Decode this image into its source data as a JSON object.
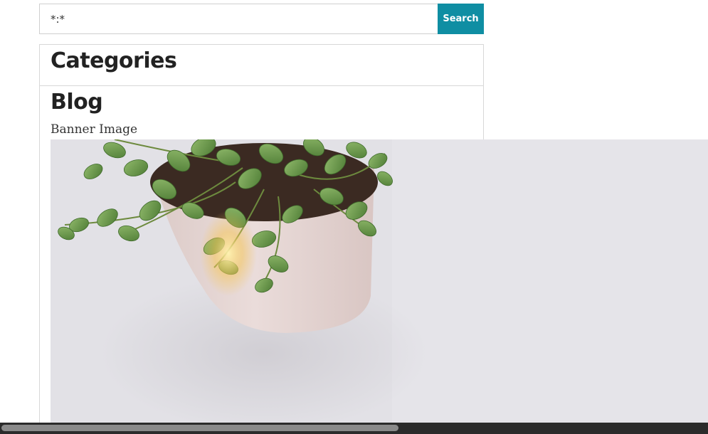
{
  "search": {
    "value": "*:*",
    "button_label": "Search"
  },
  "categories": {
    "title": "Categories"
  },
  "blog": {
    "title": "Blog",
    "banner_label": "Banner Image"
  },
  "banner": {
    "icon": "potted-plant-photo",
    "colors": {
      "background": "#e1e0e5",
      "pot": "#e9d9d6",
      "leaf": "#6d9a4c"
    }
  },
  "theme": {
    "accent": "#0f8ea3",
    "border": "#d8d8d8"
  }
}
